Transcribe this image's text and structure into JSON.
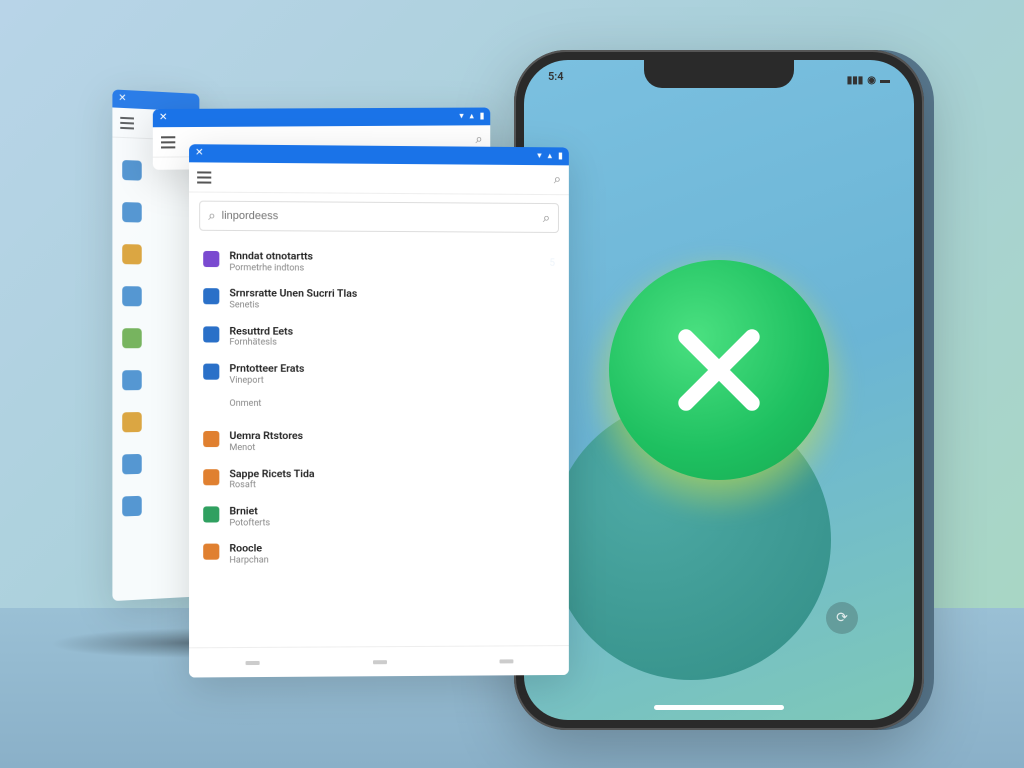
{
  "phone": {
    "status_time": "5:4",
    "action_button_glyph": "⟳"
  },
  "window_back1": {
    "search_placeholder": ""
  },
  "window_front": {
    "search_placeholder": "linpordeess",
    "list": [
      {
        "title": "Rnndat otnotartts",
        "sub": "Pormetrhe indtons",
        "icon_color": "#7a4ad0",
        "badge": "5"
      },
      {
        "title": "Srnrsratte Unen Sucrri Tlas",
        "sub": "Senetis",
        "icon_color": "#2a70c8",
        "badge": ""
      },
      {
        "title": "Resuttrd Eets",
        "sub": "Fornhätesls",
        "icon_color": "#2a70c8",
        "badge": ""
      },
      {
        "title": "Prntotteer Erats",
        "sub": "Vineport",
        "icon_color": "#2a70c8",
        "badge": ""
      },
      {
        "title": "",
        "sub": "Onment",
        "icon_color": "",
        "badge": ""
      },
      {
        "title": "Uemra Rtstores",
        "sub": "Menot",
        "icon_color": "#e08030",
        "badge": ""
      },
      {
        "title": "Sappe Ricets Tida",
        "sub": "Rosaft",
        "icon_color": "#e08030",
        "badge": ""
      },
      {
        "title": "Brniet",
        "sub": "Potofterts",
        "icon_color": "#30a060",
        "badge": ""
      },
      {
        "title": "Roocle",
        "sub": "Harpchan",
        "icon_color": "#e08030",
        "badge": ""
      }
    ]
  },
  "side_colors": [
    "#4a90d0",
    "#4a90d0",
    "#e0a030",
    "#4a90d0",
    "#70b050",
    "#4a90d0",
    "#e0a030",
    "#4a90d0",
    "#4a90d0"
  ]
}
